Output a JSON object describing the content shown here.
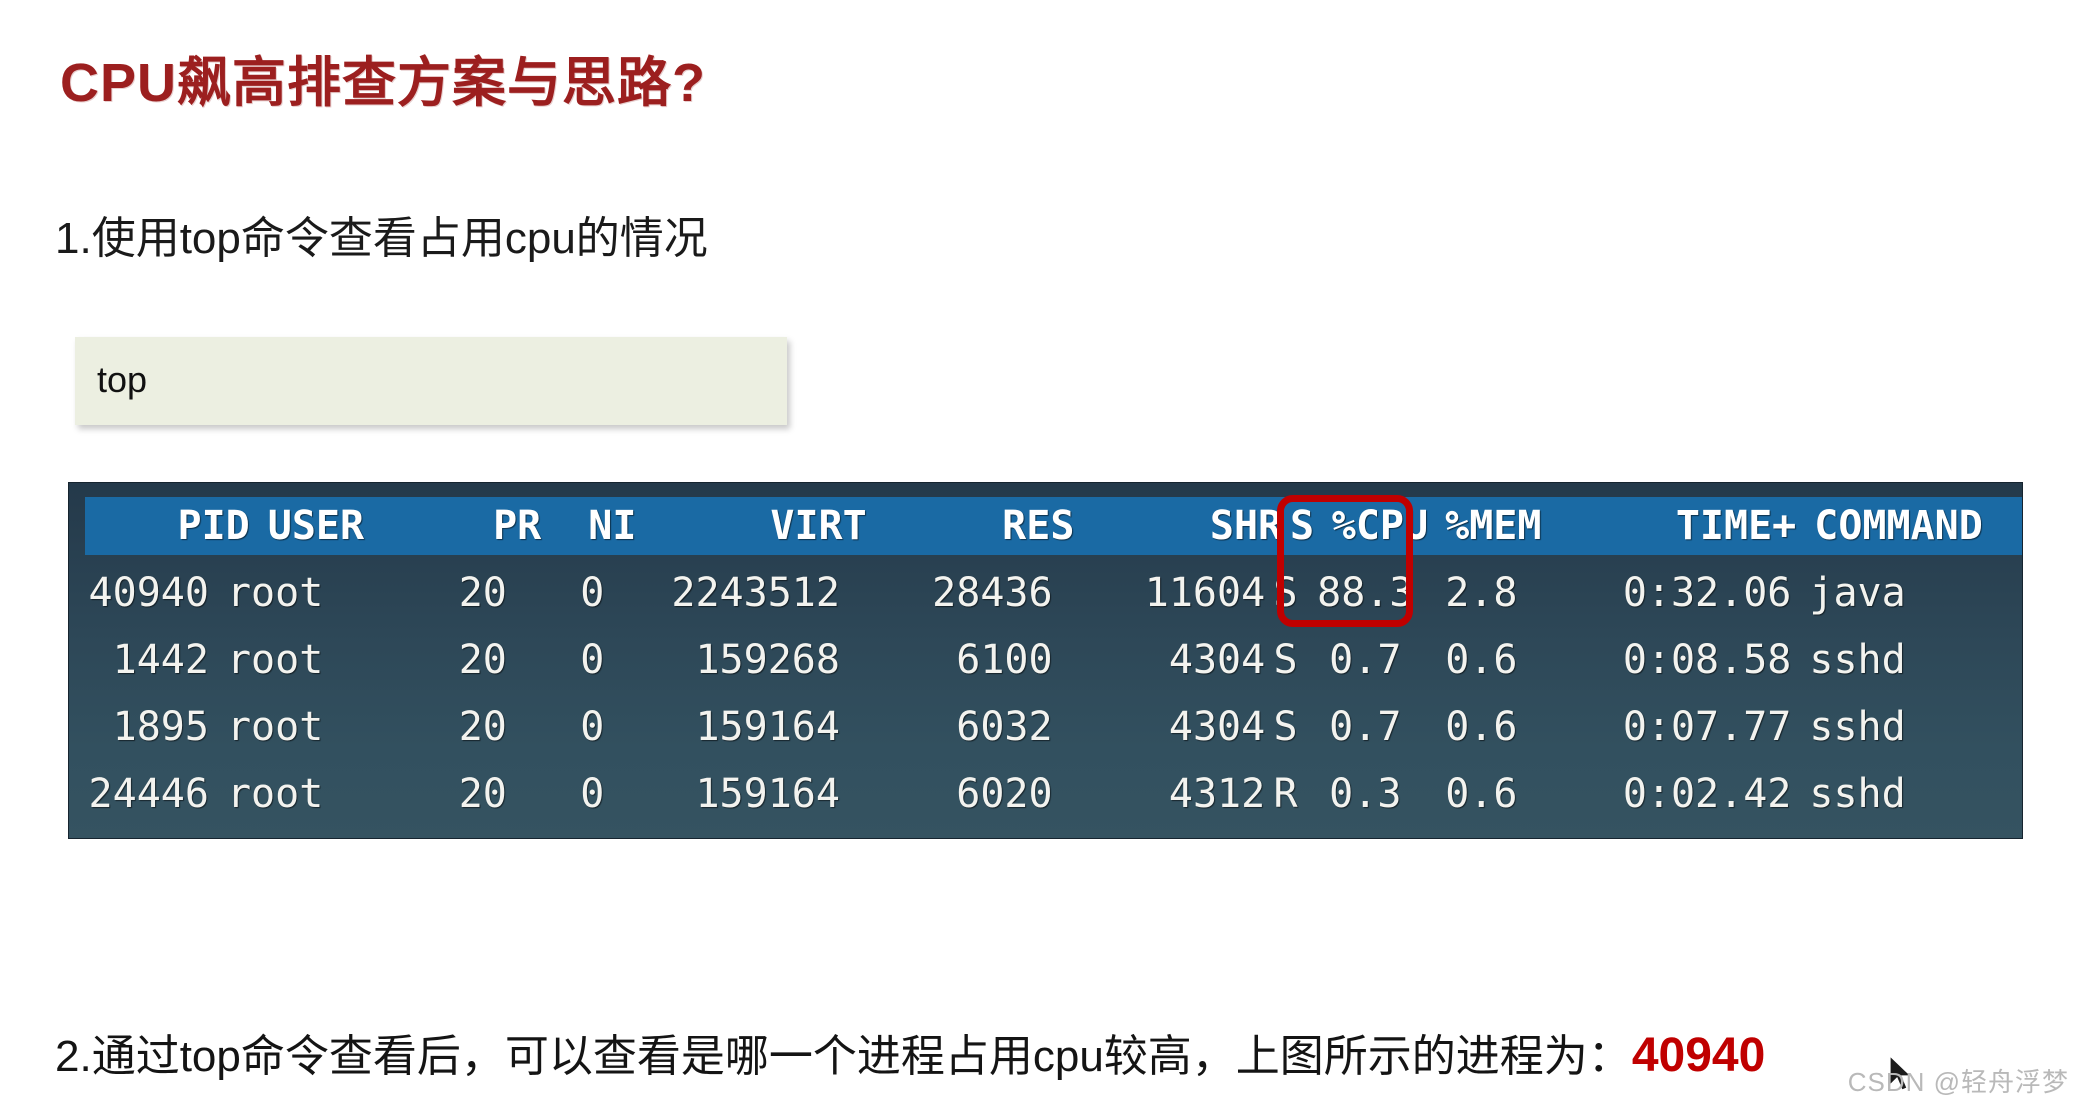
{
  "slide": {
    "title": "CPU飙高排查方案与思路?",
    "step_one": "1.使用top命令查看占用cpu的情况",
    "code_snippet": "top",
    "step_two_prefix": "2.通过top命令查看后，可以查看是哪一个进程占用cpu较高，上图所示的进程为：",
    "step_two_pid": "40940",
    "watermark": "CSDN @轻舟浮梦"
  },
  "terminal": {
    "columns": {
      "pid": "PID",
      "user": "USER",
      "pr": "PR",
      "ni": "NI",
      "virt": "VIRT",
      "res": "RES",
      "shr": "SHR",
      "s": "S",
      "cpu": "%CPU",
      "mem": "%MEM",
      "time": "TIME+",
      "command": "COMMAND"
    },
    "highlight_color": "#c00000",
    "header_bg": "#1a6aa4",
    "body_bg": "#2d4757",
    "rows": [
      {
        "pid": "40940",
        "user": "root",
        "pr": "20",
        "ni": "0",
        "virt": "2243512",
        "res": "28436",
        "shr": "11604",
        "s": "S",
        "cpu": "88.3",
        "mem": "2.8",
        "time": "0:32.06",
        "command": "java"
      },
      {
        "pid": "1442",
        "user": "root",
        "pr": "20",
        "ni": "0",
        "virt": "159268",
        "res": "6100",
        "shr": "4304",
        "s": "S",
        "cpu": "0.7",
        "mem": "0.6",
        "time": "0:08.58",
        "command": "sshd"
      },
      {
        "pid": "1895",
        "user": "root",
        "pr": "20",
        "ni": "0",
        "virt": "159164",
        "res": "6032",
        "shr": "4304",
        "s": "S",
        "cpu": "0.7",
        "mem": "0.6",
        "time": "0:07.77",
        "command": "sshd"
      },
      {
        "pid": "24446",
        "user": "root",
        "pr": "20",
        "ni": "0",
        "virt": "159164",
        "res": "6020",
        "shr": "4312",
        "s": "R",
        "cpu": "0.3",
        "mem": "0.6",
        "time": "0:02.42",
        "command": "sshd"
      }
    ]
  }
}
